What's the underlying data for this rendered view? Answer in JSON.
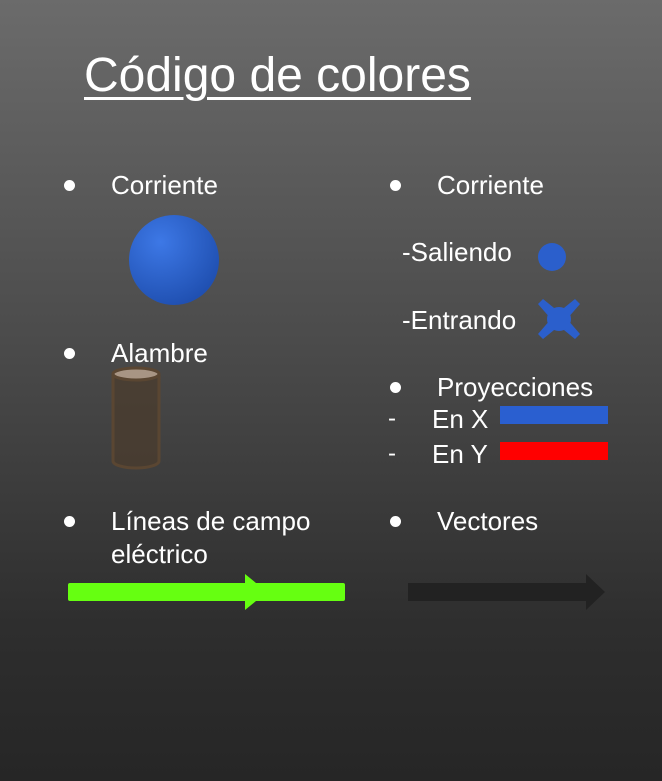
{
  "title": "Código de colores",
  "left_column": {
    "current_label": "Corriente",
    "wire_label": "Alambre",
    "field_lines_label": "Líneas de campo eléctrico",
    "field_lines_line1": "Líneas de campo",
    "field_lines_line2": "eléctrico"
  },
  "right_column": {
    "current_label": "Corriente",
    "outgoing_label": "-Saliendo",
    "incoming_label": "-Entrando",
    "projections_label": "Proyecciones",
    "projection_x_dash": "-",
    "projection_x_label": "En X",
    "projection_y_dash": "-",
    "projection_y_label": "En Y",
    "vectors_label": "Vectores"
  },
  "colors": {
    "current": "#2b5fcc",
    "projection_x": "#2a5fd0",
    "projection_y": "#ff0000",
    "field_lines": "#66ff11",
    "vector": "#222222",
    "wire": "#4e3f30"
  }
}
